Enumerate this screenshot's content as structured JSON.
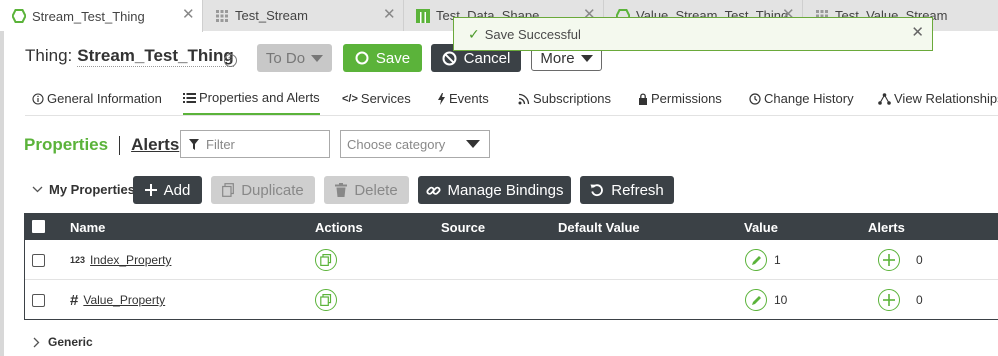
{
  "tabs": [
    {
      "label": "Stream_Test_Thing",
      "icon": "thing-hexagon-icon",
      "active": true
    },
    {
      "label": "Test_Stream",
      "icon": "stream-grid-icon",
      "active": false
    },
    {
      "label": "Test_Data_Shape",
      "icon": "datashape-icon",
      "active": false
    },
    {
      "label": "Value_Stream_Test_Thing",
      "icon": "thing-hexagon-icon",
      "active": false
    },
    {
      "label": "Test_Value_Stream",
      "icon": "stream-grid-icon",
      "active": false
    }
  ],
  "toast": {
    "message": "Save Successful"
  },
  "header": {
    "prefix": "Thing:",
    "name": "Stream_Test_Thing"
  },
  "actions": {
    "todo": "To Do",
    "save": "Save",
    "cancel": "Cancel",
    "more": "More"
  },
  "nav": [
    {
      "label": "General Information",
      "icon": "info-icon"
    },
    {
      "label": "Properties and Alerts",
      "icon": "list-icon",
      "active": true
    },
    {
      "label": "Services",
      "icon": "code-icon"
    },
    {
      "label": "Events",
      "icon": "bolt-icon"
    },
    {
      "label": "Subscriptions",
      "icon": "rss-icon"
    },
    {
      "label": "Permissions",
      "icon": "lock-icon"
    },
    {
      "label": "Change History",
      "icon": "clock-icon"
    },
    {
      "label": "View Relationships",
      "icon": "relationships-icon"
    }
  ],
  "section": {
    "properties": "Properties",
    "alerts": "Alerts"
  },
  "filter": {
    "placeholder": "Filter"
  },
  "category": {
    "placeholder": "Choose category"
  },
  "toolbar": {
    "group": "My Properties",
    "add": "Add",
    "duplicate": "Duplicate",
    "delete": "Delete",
    "manage_bindings": "Manage Bindings",
    "refresh": "Refresh"
  },
  "table": {
    "columns": [
      "Name",
      "Actions",
      "Source",
      "Default Value",
      "Value",
      "Alerts"
    ],
    "rows": [
      {
        "type": "123",
        "name": "Index_Property",
        "value": "1",
        "alerts": "0"
      },
      {
        "type": "#",
        "name": "Value_Property",
        "value": "10",
        "alerts": "0"
      }
    ]
  },
  "generic": {
    "label": "Generic"
  },
  "colors": {
    "accent": "#5bb33a",
    "dark": "#3b4146"
  }
}
